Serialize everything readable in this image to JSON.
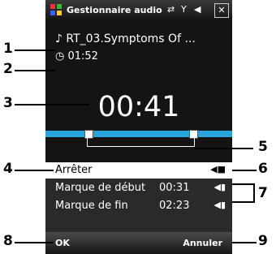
{
  "titlebar": {
    "title": "Gestionnaire audio",
    "close_label": "✕"
  },
  "track": {
    "name": "RT_03.Symptoms Of ...",
    "duration": "01:52"
  },
  "player": {
    "current_time": "00:41"
  },
  "menu": {
    "items": [
      {
        "label": "Arrêter",
        "value": ""
      },
      {
        "label": "Marque de début",
        "value": "00:31"
      },
      {
        "label": "Marque de fin",
        "value": "02:23"
      }
    ]
  },
  "softkeys": {
    "left": "OK",
    "right": "Annuler"
  },
  "callouts": [
    "1",
    "2",
    "3",
    "4",
    "5",
    "6",
    "7",
    "8",
    "9"
  ],
  "icons": [
    "start-menu-icon",
    "sync-icon",
    "signal-icon",
    "volume-icon",
    "music-note-icon",
    "clock-icon",
    "back-arrow-icon"
  ],
  "colors": {
    "accent": "#29a5dd",
    "background": "#141414"
  }
}
